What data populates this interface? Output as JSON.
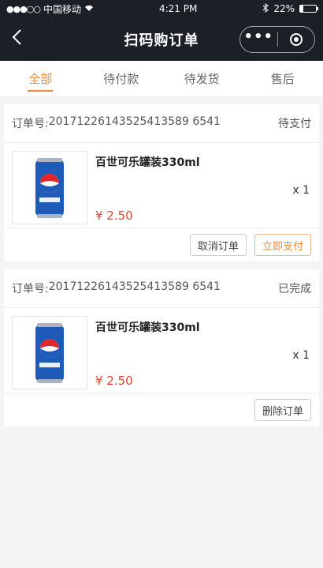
{
  "status_bar": {
    "carrier": "中国移动",
    "time": "4:21 PM",
    "battery": "22%",
    "battery_level": 0.22,
    "signal_icon": "signal-dots-icon",
    "wifi_icon": "wifi-icon",
    "bluetooth_icon": "bluetooth-icon"
  },
  "nav": {
    "title": "扫码购订单",
    "back_icon": "chevron-left-icon"
  },
  "tabs": [
    {
      "label": "全部",
      "active": true
    },
    {
      "label": "待付款",
      "active": false
    },
    {
      "label": "待发货",
      "active": false
    },
    {
      "label": "售后",
      "active": false
    }
  ],
  "orders": [
    {
      "order_no_label": "订单号:",
      "order_no": "20171226143525413589 6541",
      "status": "待支付",
      "product_name": "百世可乐罐装330ml",
      "price": "¥ 2.50",
      "qty": "x 1",
      "actions": [
        "取消订单",
        "立即支付"
      ]
    },
    {
      "order_no_label": "订单号:",
      "order_no": "20171226143525413589 6541",
      "status": "已完成",
      "product_name": "百世可乐罐装330ml",
      "price": "¥ 2.50",
      "qty": "x 1",
      "actions": [
        "删除订单"
      ]
    }
  ],
  "colors": {
    "accent": "#f0883a",
    "price": "#e5472d",
    "nav_bg": "#1b1f26"
  }
}
